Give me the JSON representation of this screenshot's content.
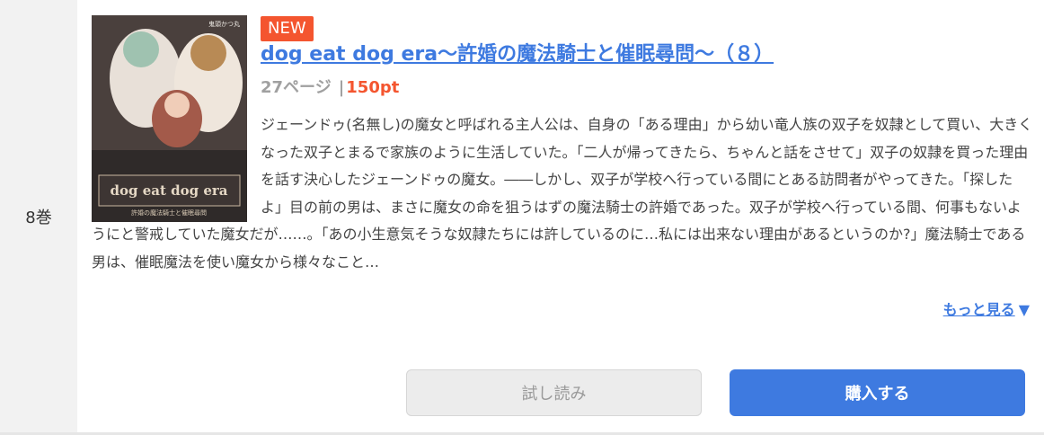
{
  "volume": {
    "label": "8巻"
  },
  "item": {
    "badge": "NEW",
    "title": "dog eat dog era～許婚の魔法騎士と催眠尋問～（８）",
    "pages": "27ページ",
    "separator": "|",
    "price": "150pt",
    "description": "ジェーンドゥ(名無し)の魔女と呼ばれる主人公は、自身の「ある理由」から幼い竜人族の双子を奴隷として買い、大きくなった双子とまるで家族のように生活していた。「二人が帰ってきたら、ちゃんと話をさせて」双子の奴隷を買った理由を話す決心したジェーンドゥの魔女。――しかし、双子が学校へ行っている間にとある訪問者がやってきた。「探したよ」目の前の男は、まさに魔女の命を狙うはずの魔法騎士の許婚であった。双子が学校へ行っている間、何事もないようにと警戒していた魔女だが……。「あの小生意気そうな奴隷たちには許しているのに…私には出来ない理由があるというのか?」魔法騎士である男は、催眠魔法を使い魔女から様々なこと…",
    "more_label": "もっと見る",
    "more_arrow": "▼",
    "cover": {
      "logo_text": "dog eat dog era",
      "subtitle": "許婚の魔法騎士と催眠尋問",
      "author": "鬼頭かつ丸"
    }
  },
  "actions": {
    "trial_label": "試し読み",
    "buy_label": "購入する"
  },
  "colors": {
    "accent": "#3e7ae0",
    "badge": "#f4552f",
    "price": "#f4552f"
  }
}
